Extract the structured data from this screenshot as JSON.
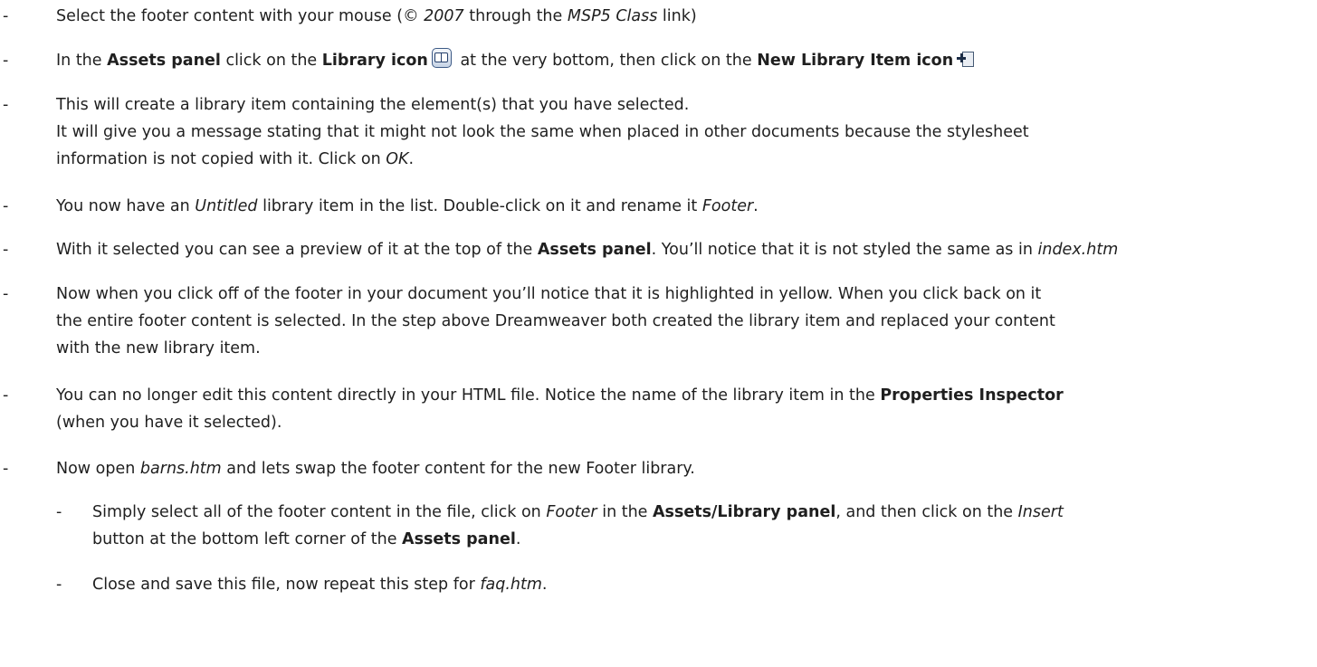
{
  "bullet": "-",
  "steps": [
    {
      "parts": [
        "Select the footer content with your mouse (© ",
        "2007",
        " through the ",
        "MSP5 Class",
        " link)"
      ]
    },
    {
      "parts": [
        "In the ",
        "Assets panel",
        " click on the ",
        "Library icon",
        " at the very bottom, then click on the ",
        "New Library Item icon"
      ],
      "icons": [
        "library-icon",
        "new-library-item-icon"
      ]
    },
    {
      "lines": [
        [
          "This will create a library item containing the element(s) that you have selected."
        ],
        [
          "It will give you a message stating that it might not look the same when placed in other documents because the stylesheet"
        ],
        [
          "information is not copied with it. Click on ",
          "OK",
          "."
        ]
      ]
    },
    {
      "parts": [
        "You now have an ",
        "Untitled",
        " library item in the list. Double-click on it and rename it ",
        "Footer",
        "."
      ]
    },
    {
      "parts": [
        "With it selected you can see a preview of it at the top of the ",
        "Assets panel",
        ". You’ll notice that it is not styled the same as in ",
        "index.htm"
      ]
    },
    {
      "lines": [
        [
          "Now when you click off of the footer in your document you’ll notice that it is highlighted in yellow. When you click back on it"
        ],
        [
          "the entire footer content is selected. In the step above Dreamweaver both created the library item and replaced your content"
        ],
        [
          "with the new library item."
        ]
      ]
    },
    {
      "lines": [
        [
          "You can no longer edit this content directly in your HTML file. Notice the name of the library item in the ",
          "Properties Inspector"
        ],
        [
          "(when you have it selected)."
        ]
      ]
    },
    {
      "parts": [
        "Now open ",
        "barns.htm",
        " and lets swap the footer content for the new Footer library."
      ]
    }
  ],
  "substeps": [
    {
      "lines": [
        [
          "Simply select all of the footer content in the file, click on ",
          "Footer",
          " in the ",
          "Assets/Library panel",
          ", and then click on the ",
          "Insert"
        ],
        [
          "button at the bottom left corner of the ",
          "Assets panel",
          "."
        ]
      ]
    },
    {
      "parts": [
        "Close and save this file, now repeat this step for ",
        "faq.htm",
        "."
      ]
    }
  ]
}
